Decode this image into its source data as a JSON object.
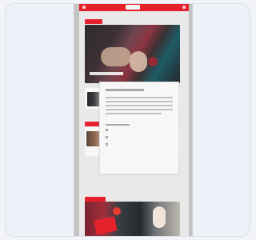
{
  "app": {
    "title": "",
    "accent_color": "#e5212c"
  },
  "header": {
    "logo_label": "",
    "menu_icon": "menu-icon",
    "profile_icon": "profile-icon"
  },
  "hero": {
    "section_label": "",
    "headline": ""
  },
  "cookie_modal": {
    "title": "",
    "body": "",
    "checkbox_label": "",
    "primary_button": "",
    "secondary_buttons": [
      "",
      "",
      ""
    ]
  },
  "sections": {
    "news_label": "",
    "promo_label": ""
  },
  "colors": {
    "cta_green": "#79c56b",
    "background": "#eef1f8",
    "device_gray": "#c3c3c3"
  }
}
